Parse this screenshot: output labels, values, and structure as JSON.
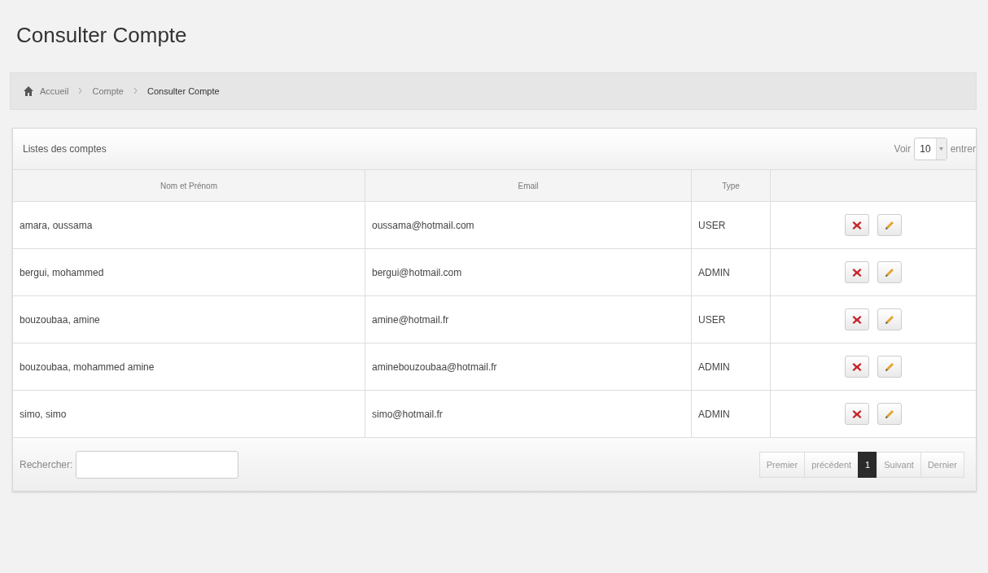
{
  "page_title": "Consulter Compte",
  "breadcrumb": [
    {
      "label": "Accueil",
      "current": false
    },
    {
      "label": "Compte",
      "current": false
    },
    {
      "label": "Consulter Compte",
      "current": true
    }
  ],
  "panel": {
    "title": "Listes des comptes",
    "length_prefix": "Voir",
    "length_value": "10",
    "length_suffix": "entrer"
  },
  "table": {
    "columns": [
      "Nom et Prénom",
      "Email",
      "Type"
    ],
    "rows": [
      {
        "name": "amara, oussama",
        "email": "oussama@hotmail.com",
        "type": "USER"
      },
      {
        "name": "bergui, mohammed",
        "email": "bergui@hotmail.com",
        "type": "ADMIN"
      },
      {
        "name": "bouzoubaa, amine",
        "email": "amine@hotmail.fr",
        "type": "USER"
      },
      {
        "name": "bouzoubaa, mohammed amine",
        "email": "aminebouzoubaa@hotmail.fr",
        "type": "ADMIN"
      },
      {
        "name": "simo, simo",
        "email": "simo@hotmail.fr",
        "type": "ADMIN"
      }
    ]
  },
  "search": {
    "label": "Rechercher:"
  },
  "pagination": [
    {
      "label": "Premier",
      "selected": false
    },
    {
      "label": "précédent",
      "selected": false
    },
    {
      "label": "1",
      "selected": true
    },
    {
      "label": "Suivant",
      "selected": false
    },
    {
      "label": "Dernier",
      "selected": false
    }
  ]
}
